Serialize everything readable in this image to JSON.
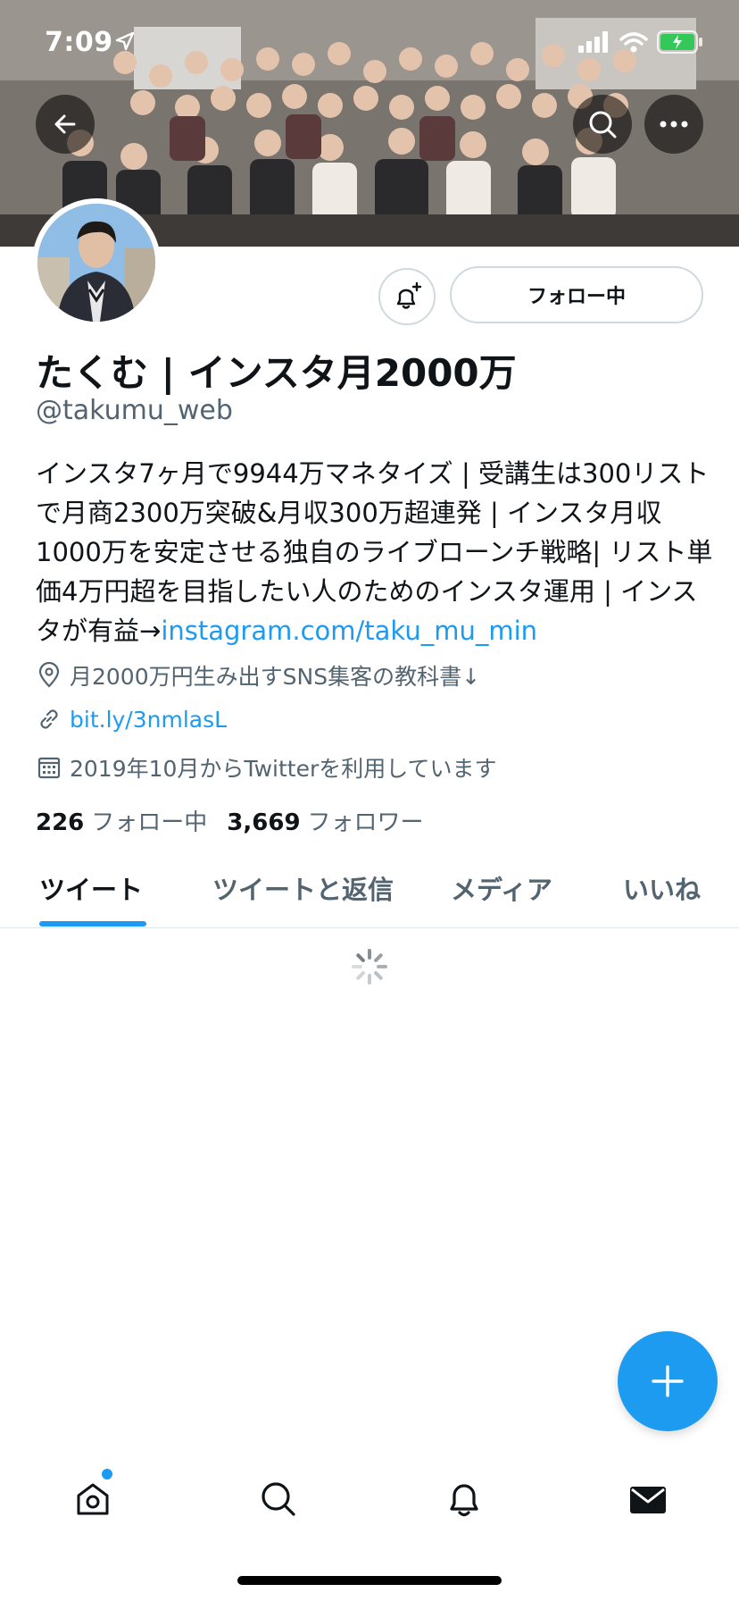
{
  "status_bar": {
    "time": "7:09"
  },
  "profile": {
    "name": "たくむ | インスタ月2000万",
    "handle": "@takumu_web",
    "bio_text": "インスタ7ヶ月で9944万マネタイズ | 受講生は300リストで月商2300万突破&月収300万超連発 | インスタ月収1000万を安定させる独自のライブローンチ戦略| リスト単価4万円超を目指したい人のためのインスタ運用 | インスタが有益→",
    "bio_link": "instagram.com/taku_mu_min",
    "location": "月2000万円生み出すSNS集客の教科書↓",
    "website": "bit.ly/3nmlasL",
    "joined": "2019年10月からTwitterを利用しています",
    "following_count": "226",
    "following_label": "フォロー中",
    "followers_count": "3,669",
    "followers_label": "フォロワー",
    "follow_button_label": "フォロー中"
  },
  "tabs": [
    {
      "label": "ツイート",
      "active": true
    },
    {
      "label": "ツイートと返信",
      "active": false
    },
    {
      "label": "メディア",
      "active": false
    },
    {
      "label": "いいね",
      "active": false
    }
  ],
  "colors": {
    "accent": "#1d9bf0",
    "text": "#0f1419",
    "secondary": "#536471"
  },
  "icons": [
    "back-arrow-icon",
    "search-icon",
    "more-icon",
    "bell-plus-icon",
    "location-pin-icon",
    "link-icon",
    "calendar-icon",
    "spinner-icon",
    "compose-plus-icon",
    "home-icon",
    "search-icon",
    "bell-icon",
    "mail-icon"
  ]
}
